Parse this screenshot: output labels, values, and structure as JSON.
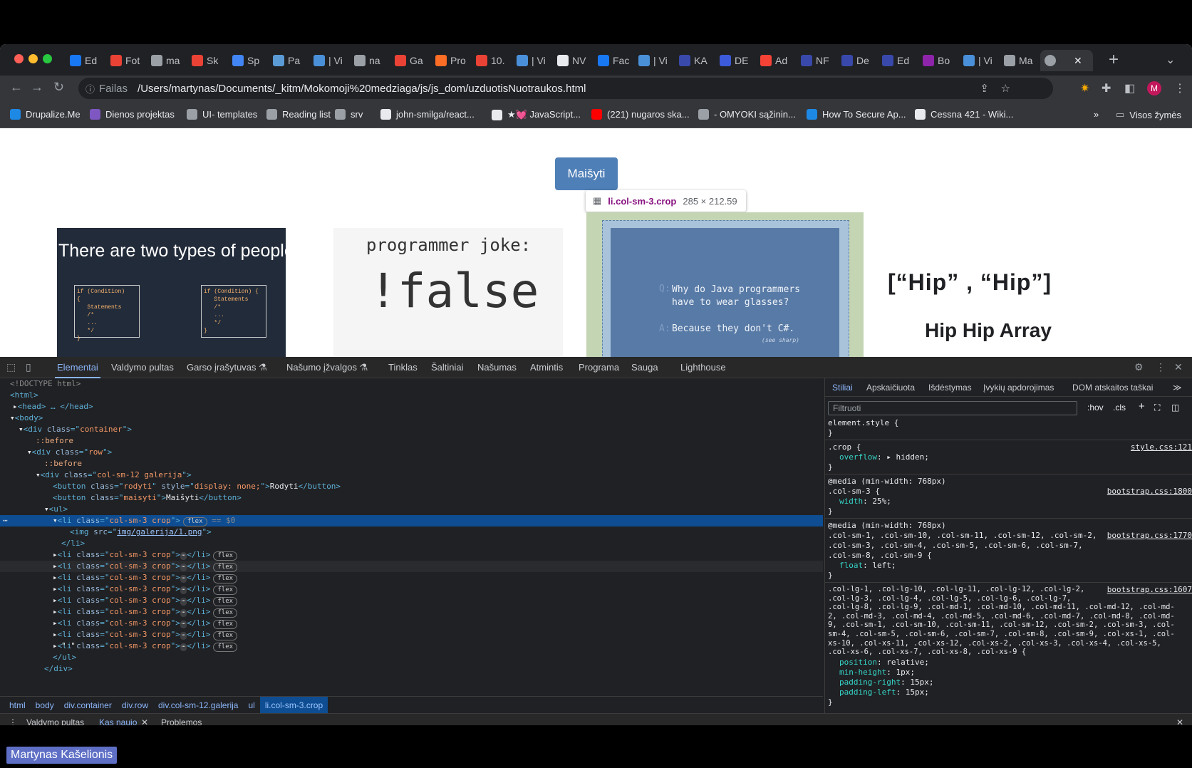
{
  "browser": {
    "tabs": [
      {
        "label": "Ed",
        "color": "#1877f2"
      },
      {
        "label": "Fot",
        "color": "#ea4335"
      },
      {
        "label": "ma",
        "color": "#9aa0a6"
      },
      {
        "label": "Sk",
        "color": "#ea4335"
      },
      {
        "label": "Sp",
        "color": "#4285f4"
      },
      {
        "label": "Pa",
        "color": "#5b9bd5"
      },
      {
        "label": "| Vi",
        "color": "#4a90d9"
      },
      {
        "label": "na",
        "color": "#9aa0a6"
      },
      {
        "label": "Ga",
        "color": "#ea4335"
      },
      {
        "label": "Pro",
        "color": "#fc6d26"
      },
      {
        "label": "10.",
        "color": "#ea4335"
      },
      {
        "label": "| Vi",
        "color": "#4a90d9"
      },
      {
        "label": "NV",
        "color": "#e8eaed"
      },
      {
        "label": "Fac",
        "color": "#1877f2"
      },
      {
        "label": "| Vi",
        "color": "#4a90d9"
      },
      {
        "label": "KA",
        "color": "#3949ab"
      },
      {
        "label": "DE",
        "color": "#3b5bdb"
      },
      {
        "label": "Ad",
        "color": "#f44336"
      },
      {
        "label": "NF",
        "color": "#3949ab"
      },
      {
        "label": "De",
        "color": "#3949ab"
      },
      {
        "label": "Ed",
        "color": "#3949ab"
      },
      {
        "label": "Bo",
        "color": "#8e24aa"
      },
      {
        "label": "| Vi",
        "color": "#4a90d9"
      },
      {
        "label": "Ma",
        "color": "#9aa0a6"
      }
    ],
    "active_tab_close": "✕",
    "new_tab": "+",
    "address": {
      "label": "Failas",
      "url": "/Users/martynas/Documents/_kitm/Mokomoji%20medziaga/js/js_dom/uzduotisNuotraukos.html"
    },
    "avatar_letter": "M",
    "bookmarks": [
      {
        "label": "Drupalize.Me",
        "color": "#1e88e5"
      },
      {
        "label": "Dienos projektas",
        "color": "#7e57c2"
      },
      {
        "label": "UI- templates",
        "color": "#9aa0a6"
      },
      {
        "label": "Reading list",
        "color": "#9aa0a6"
      },
      {
        "label": "srv",
        "color": "#9aa0a6"
      },
      {
        "label": "john-smilga/react...",
        "color": "#e8eaed"
      },
      {
        "label": "★💓 JavaScript...",
        "color": "#e8eaed"
      },
      {
        "label": "(221) nugaros ska...",
        "color": "#ff0000"
      },
      {
        "label": "- OMYOKI sąžinin...",
        "color": "#9aa0a6"
      },
      {
        "label": "How To Secure Ap...",
        "color": "#1e88e5"
      },
      {
        "label": "Cessna 421 - Wiki...",
        "color": "#e8eaed"
      }
    ],
    "bookmarks_overflow": "»",
    "all_bookmarks": "Visos žymės"
  },
  "page": {
    "button_label": "Maišyti",
    "tooltip": {
      "selector": "li.col-sm-3.crop",
      "size": "285 × 212.59"
    },
    "image1": {
      "title": "There are two types of people.",
      "code_left": "if (Condition)\n{\n   Statements\n   /*\n   ...\n   */\n}",
      "code_right": "if (Condition) {\n   Statements\n   /*\n   ...\n   */\n}"
    },
    "image2": {
      "line1": "programmer joke:",
      "line2": "!false"
    },
    "image3": {
      "q_marker": "Q:",
      "question": "Why do Java programmers\nhave to wear glasses?",
      "a_marker": "A:",
      "answer": "Because they don't C#.",
      "signature": "(see sharp)"
    },
    "image4": {
      "line1": "[“Hip” , “Hip”]",
      "line2": "Hip Hip Array"
    }
  },
  "devtools": {
    "tabs": [
      "Elementai",
      "Valdymo pultas",
      "Garso įrašytuvas ⚗",
      "Našumo įžvalgos ⚗",
      "Tinklas",
      "Šaltiniai",
      "Našumas",
      "Atmintis",
      "Programa",
      "Sauga",
      "Lighthouse"
    ],
    "dom_lines": [
      "<!DOCTYPE html>",
      "<html>",
      "<head> … </head>",
      "<body>",
      "<div class=\"container\">",
      "::before",
      "<div class=\"row\">",
      "::before",
      "<div class=\"col-sm-12 galerija\">",
      "<button class=\"rodyti\" style=\"display: none;\">Rodyti</button>",
      "<button class=\"maisyti\">Maišyti</button>",
      "<ul>",
      "<li class=\"col-sm-3 crop\">",
      "<img src=\"img/galerija/1.png\">",
      "</li>",
      "<li class=\"col-sm-3 crop\"> … </li>",
      "\" \"",
      "</ul>",
      "</div>"
    ],
    "flex_badge": "flex",
    "sel_marker": "== $0",
    "breadcrumbs": [
      "html",
      "body",
      "div.container",
      "div.row",
      "div.col-sm-12.galerija",
      "ul",
      "li.col-sm-3.crop"
    ],
    "styles_tabs": [
      "Stiliai",
      "Apskaičiuota",
      "Išdėstymas",
      "Įvykių apdorojimas",
      "DOM atskaitos taškai"
    ],
    "filter_placeholder": "Filtruoti",
    "filter_tools": [
      ":hov",
      ".cls"
    ],
    "rules": {
      "r1_sel": "element.style {",
      "close": "}",
      "r2_sel": ".crop {",
      "r2_link": "style.css:121",
      "r2_prop": "overflow",
      "r2_val": "▸ hidden;",
      "r3_media": "@media (min-width: 768px)",
      "r3_sel": ".col-sm-3 {",
      "r3_link": "bootstrap.css:1800",
      "r3_prop": "width",
      "r3_val": "25%;",
      "r4_media": "@media (min-width: 768px)",
      "r4_sel": ".col-sm-1, .col-sm-10, .col-sm-11, .col-sm-12, .col-sm-2,\n.col-sm-3, .col-sm-4, .col-sm-5, .col-sm-6, .col-sm-7,\n.col-sm-8, .col-sm-9 {",
      "r4_link": "bootstrap.css:1770",
      "r4_prop": "float",
      "r4_val": "left;",
      "r5_sel": ".col-lg-1, .col-lg-10, .col-lg-11, .col-lg-12, .col-lg-2,\n.col-lg-3, .col-lg-4, .col-lg-5, .col-lg-6, .col-lg-7,\n.col-lg-8, .col-lg-9, .col-md-1, .col-md-10, .col-md-11, .col-md-12, .col-md-\n2, .col-md-3, .col-md-4, .col-md-5, .col-md-6, .col-md-7, .col-md-8, .col-md-\n9, .col-sm-1, .col-sm-10, .col-sm-11, .col-sm-12, .col-sm-2, .col-sm-3, .col-\nsm-4, .col-sm-5, .col-sm-6, .col-sm-7, .col-sm-8, .col-sm-9, .col-xs-1, .col-\nxs-10, .col-xs-11, .col-xs-12, .col-xs-2, .col-xs-3, .col-xs-4, .col-xs-5,\n.col-xs-6, .col-xs-7, .col-xs-8, .col-xs-9 {",
      "r5_link": "bootstrap.css:1607",
      "r5_p1": "position",
      "r5_v1": "relative;",
      "r5_p2": "min-height",
      "r5_v2": "1px;",
      "r5_p3": "padding-right",
      "r5_v3": "15px;",
      "r5_p4": "padding-left",
      "r5_v4": "15px;"
    },
    "drawer_tabs": [
      "Valdymo pultas",
      "Kas naujo",
      "Problemos"
    ]
  },
  "participant_name": "Martynas Kašelionis"
}
